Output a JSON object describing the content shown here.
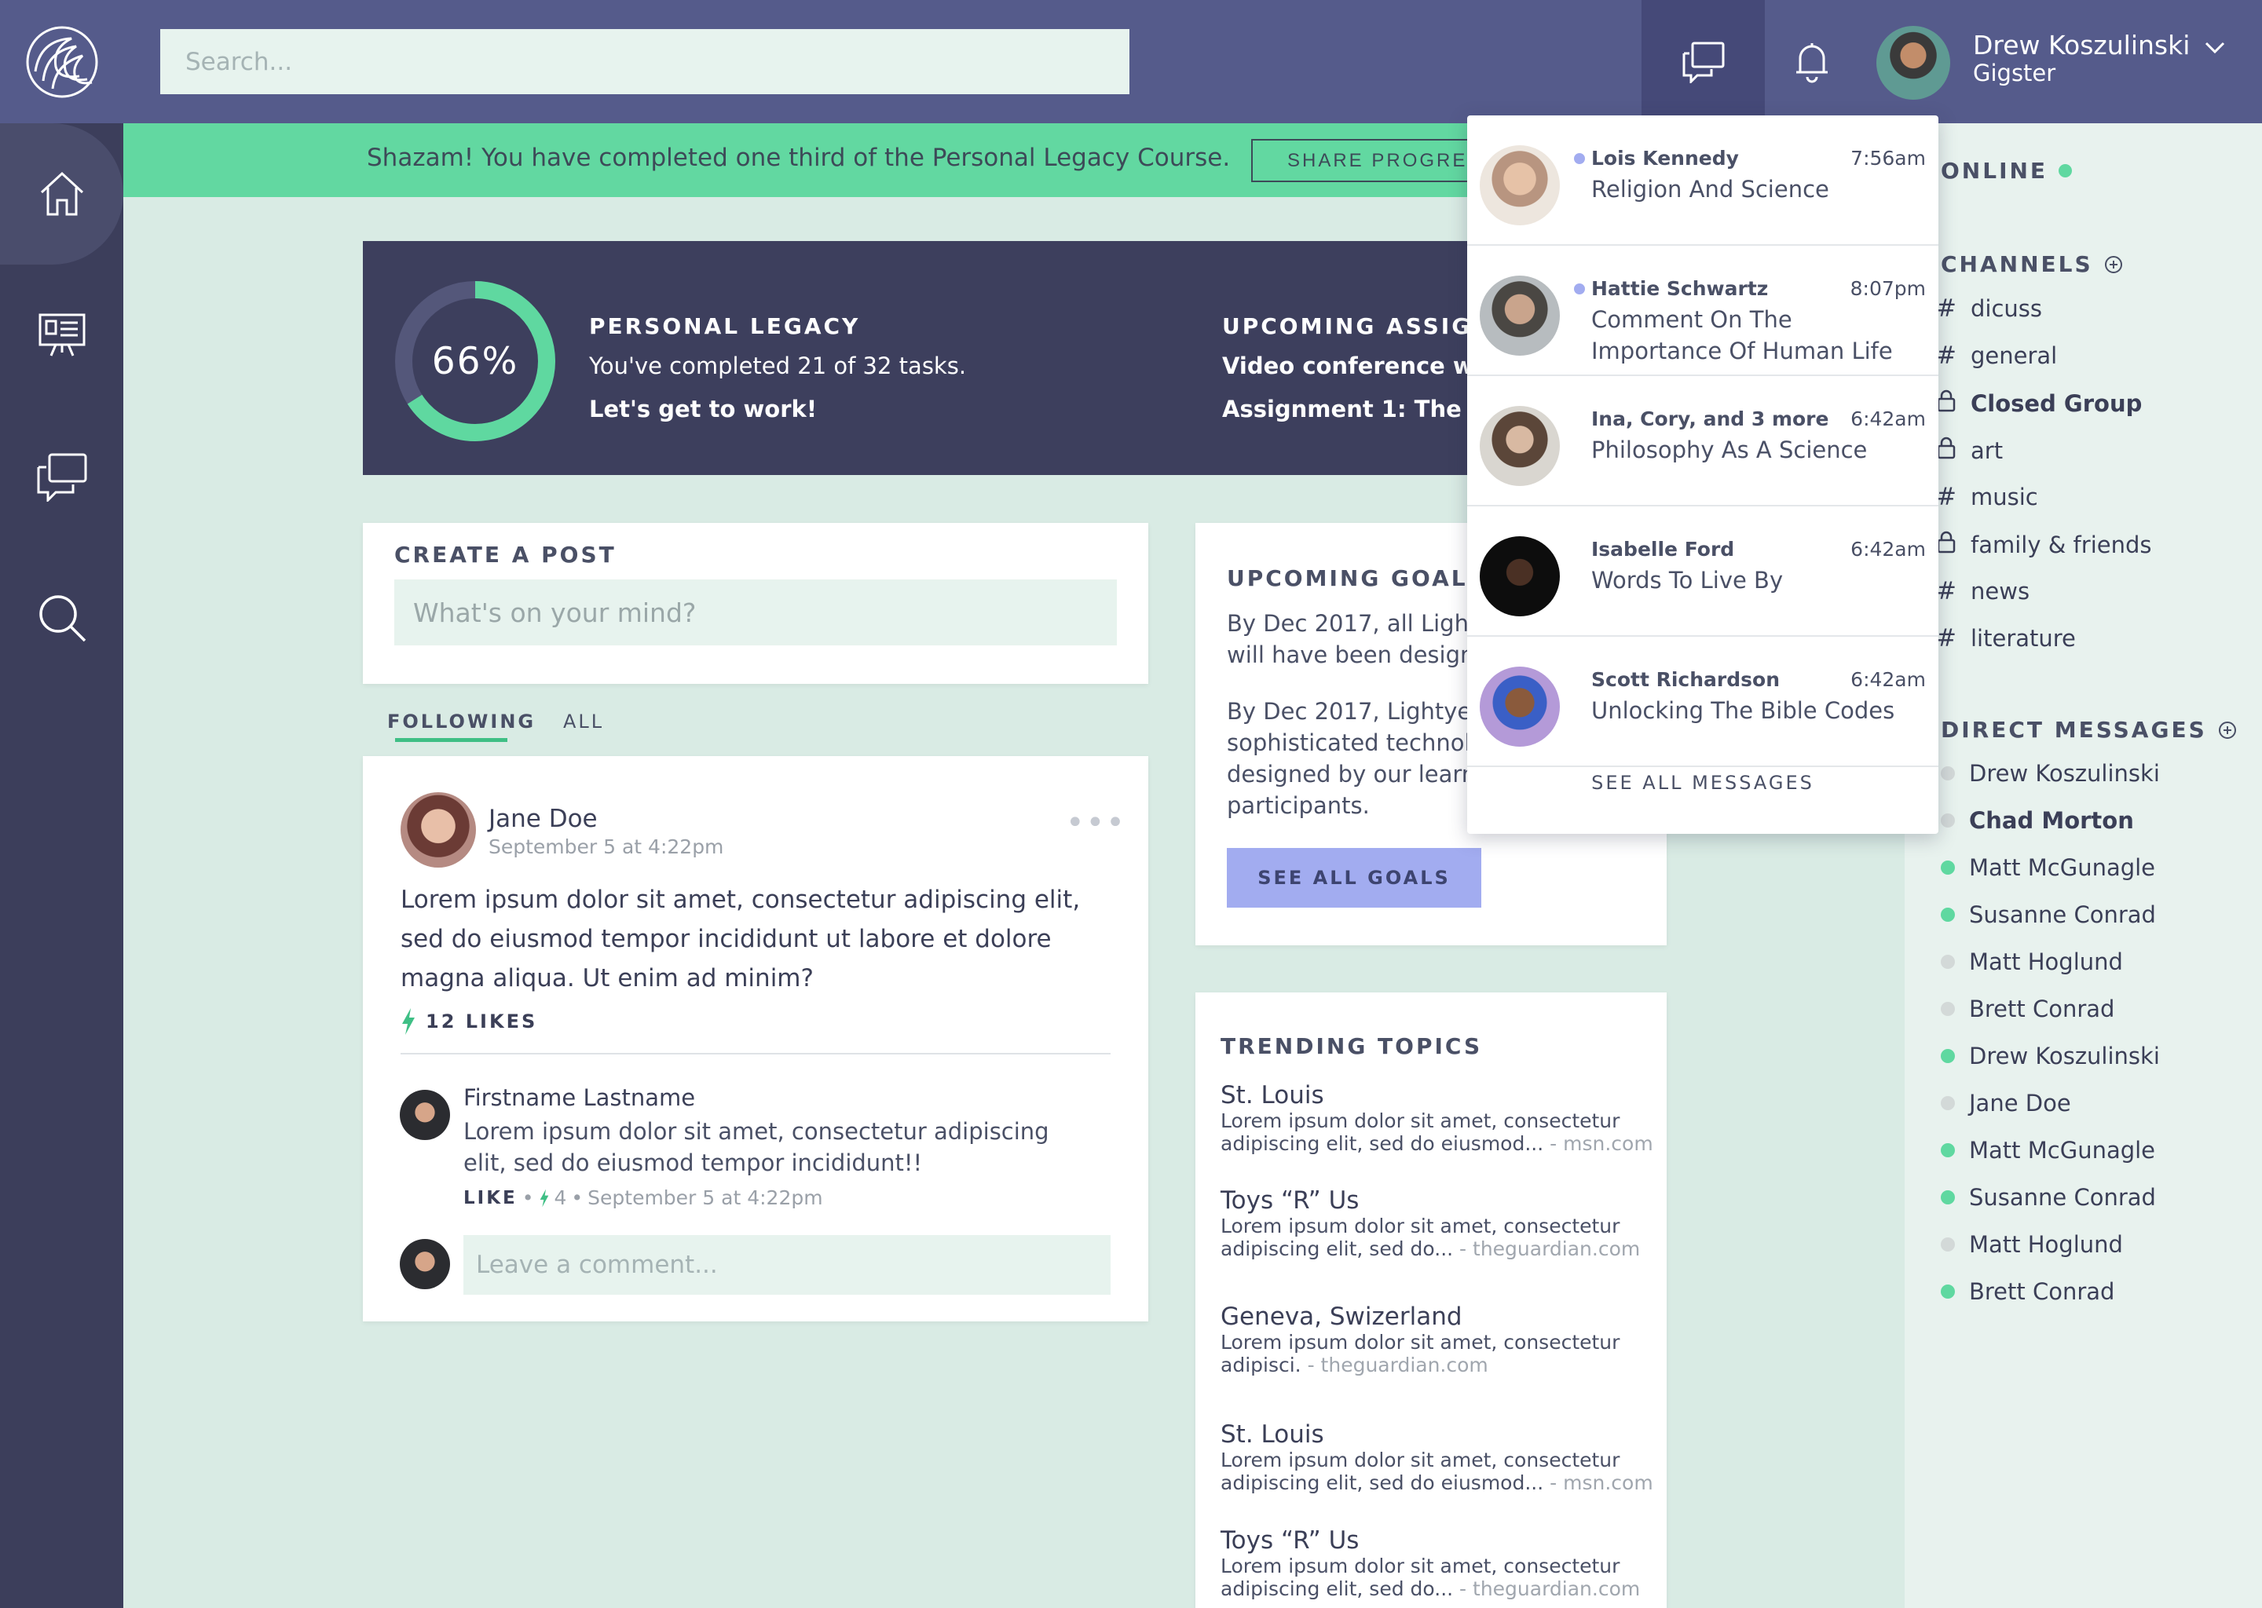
{
  "sidebar": {
    "nav": [
      {
        "icon": "home-icon"
      },
      {
        "icon": "presentation-icon"
      },
      {
        "icon": "chat-icon"
      },
      {
        "icon": "search-icon"
      }
    ]
  },
  "topbar": {
    "search_placeholder": "Search...",
    "user": {
      "name": "Drew Koszulinski",
      "role": "Gigster"
    }
  },
  "banner": {
    "text": "Shazam! You have completed one third of the Personal Legacy Course.",
    "button": "SHARE PROGRESS"
  },
  "hero": {
    "progress_label": "66%",
    "progress_value": 0.66,
    "title": "PERSONAL LEGACY",
    "subtitle": "You've completed 21 of 32 tasks.",
    "cta": "Let's get to work!",
    "upcoming_title": "UPCOMING ASSIGNMENTS",
    "upcoming_1": "Video conference with",
    "upcoming_2": "Assignment 1: The Po"
  },
  "create_post": {
    "title": "CREATE A POST",
    "placeholder": "What's on your mind?"
  },
  "tabs": {
    "following": "FOLLOWING",
    "all": "ALL"
  },
  "post": {
    "author": "Jane Doe",
    "date": "September 5 at 4:22pm",
    "more": "•••",
    "body": "Lorem ipsum dolor sit amet, consectetur adipiscing elit, sed do eiusmod tempor incididunt ut labore et dolore magna aliqua. Ut enim ad minim?",
    "likes": "12 LIKES",
    "comment": {
      "author": "Firstname Lastname",
      "body": "Lorem ipsum dolor sit amet, consectetur adipiscing elit, sed do eiusmod tempor incididunt!!",
      "like_label": "LIKE",
      "like_count": "4",
      "date": "September 5 at 4:22pm"
    },
    "reply_placeholder": "Leave a comment..."
  },
  "goals": {
    "title": "UPCOMING GOALS",
    "goal_1": "By Dec 2017, all Lightyear courses will have been designed and",
    "goal_2": "By Dec 2017, Lightyear will use sophisticated technology, co- designed by our learning participants.",
    "button": "SEE ALL GOALS"
  },
  "trending": {
    "title": "TRENDING TOPICS",
    "topics": [
      {
        "title": "St. Louis",
        "desc": "Lorem ipsum dolor sit amet, consectetur adipiscing elit, sed do eiusmod...",
        "source": "- msn.com"
      },
      {
        "title": "Toys “R” Us",
        "desc": "Lorem ipsum dolor sit amet, consectetur adipiscing elit, sed do...",
        "source": "- theguardian.com"
      },
      {
        "title": "Geneva, Swizerland",
        "desc": "Lorem ipsum dolor sit amet, consectetur adipisci.",
        "source": "- theguardian.com"
      },
      {
        "title": "St. Louis",
        "desc": "Lorem ipsum dolor sit amet, consectetur adipiscing elit, sed do eiusmod...",
        "source": "- msn.com"
      },
      {
        "title": "Toys “R” Us",
        "desc": "Lorem ipsum dolor sit amet, consectetur adipiscing elit, sed do...",
        "source": "- theguardian.com"
      }
    ]
  },
  "right_panel": {
    "online": "ONLINE",
    "channels_title": "CHANNELS",
    "channels": [
      {
        "name": "dicuss",
        "prefix": "#",
        "bold": false
      },
      {
        "name": "general",
        "prefix": "#",
        "bold": false
      },
      {
        "name": "Closed Group",
        "prefix": "lock",
        "bold": true
      },
      {
        "name": "art",
        "prefix": "lock",
        "bold": false
      },
      {
        "name": "music",
        "prefix": "#",
        "bold": false
      },
      {
        "name": "family & friends",
        "prefix": "lock",
        "bold": false
      },
      {
        "name": "news",
        "prefix": "#",
        "bold": false
      },
      {
        "name": "literature",
        "prefix": "#",
        "bold": false
      }
    ],
    "dm_title": "DIRECT MESSAGES",
    "dms": [
      {
        "name": "Drew Koszulinski",
        "online": false,
        "bold": false
      },
      {
        "name": "Chad Morton",
        "online": false,
        "bold": true
      },
      {
        "name": "Matt McGunagle",
        "online": true,
        "bold": false
      },
      {
        "name": "Susanne Conrad",
        "online": true,
        "bold": false
      },
      {
        "name": "Matt Hoglund",
        "online": false,
        "bold": false
      },
      {
        "name": "Brett Conrad",
        "online": false,
        "bold": false
      },
      {
        "name": "Drew Koszulinski",
        "online": true,
        "bold": false
      },
      {
        "name": "Jane Doe",
        "online": false,
        "bold": false
      },
      {
        "name": "Matt McGunagle",
        "online": true,
        "bold": false
      },
      {
        "name": "Susanne Conrad",
        "online": true,
        "bold": false
      },
      {
        "name": "Matt Hoglund",
        "online": false,
        "bold": false
      },
      {
        "name": "Brett Conrad",
        "online": true,
        "bold": false
      }
    ]
  },
  "messages": {
    "items": [
      {
        "from": "Lois Kennedy",
        "time": "7:56am",
        "subject": "Religion And Science",
        "unread": true
      },
      {
        "from": "Hattie Schwartz",
        "time": "8:07pm",
        "subject": "Comment On The Importance Of Human Life",
        "unread": true
      },
      {
        "from": "Ina, Cory, and 3 more",
        "time": "6:42am",
        "subject": "Philosophy As A Science",
        "unread": false
      },
      {
        "from": "Isabelle Ford",
        "time": "6:42am",
        "subject": "Words To Live By",
        "unread": false
      },
      {
        "from": "Scott Richardson",
        "time": "6:42am",
        "subject": "Unlocking The Bible Codes",
        "unread": false
      }
    ],
    "see_all": "SEE ALL MESSAGES"
  },
  "colors": {
    "sidebar": "#3c3e5b",
    "topbar": "#555b8b",
    "accent_green": "#62d8a1",
    "accent_purple": "#a2acf0",
    "background": "#d9ebe4"
  }
}
